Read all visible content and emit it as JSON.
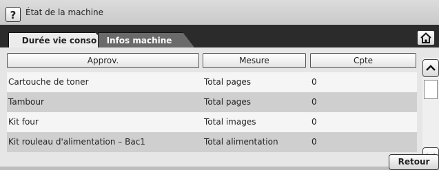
{
  "window": {
    "title": "État de la machine"
  },
  "tabs": [
    {
      "label": "Durée vie conso",
      "active": true
    },
    {
      "label": "Infos machine",
      "active": false
    }
  ],
  "table": {
    "headers": [
      "Approv.",
      "Mesure",
      "Cpte"
    ],
    "rows": [
      [
        "Cartouche de toner",
        "Total pages",
        "0"
      ],
      [
        "Tambour",
        "Total pages",
        "0"
      ],
      [
        "Kit four",
        "Total images",
        "0"
      ],
      [
        "Kit rouleau d'alimentation – Bac1",
        "Total alimentation",
        "0"
      ]
    ]
  },
  "buttons": {
    "retour": "Retour",
    "help": "?"
  },
  "icons": {
    "home": "home-icon",
    "up": "chevron-up-icon",
    "down": "chevron-down-icon"
  }
}
